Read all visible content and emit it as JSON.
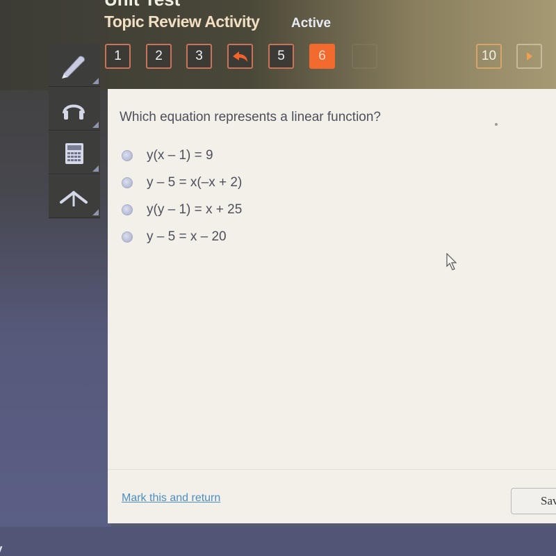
{
  "header": {
    "unit_title": "Unit Test",
    "activity_title": "Topic Review Activity",
    "status": "Active"
  },
  "question_nav": {
    "items": [
      {
        "label": "1",
        "state": "default"
      },
      {
        "label": "2",
        "state": "default"
      },
      {
        "label": "3",
        "state": "default"
      },
      {
        "label": "",
        "icon": "return-arrow-icon",
        "state": "marked"
      },
      {
        "label": "5",
        "state": "default"
      },
      {
        "label": "6",
        "state": "current"
      },
      {
        "label": "",
        "state": "hidden"
      },
      {
        "label": "10",
        "state": "default"
      },
      {
        "label": "",
        "icon": "next-arrow-icon",
        "state": "next"
      }
    ],
    "accent_color": "#f26a2e"
  },
  "tools": [
    {
      "name": "pencil",
      "icon": "pencil-icon"
    },
    {
      "name": "audio",
      "icon": "headphones-icon"
    },
    {
      "name": "calculator",
      "icon": "calculator-icon"
    },
    {
      "name": "reference",
      "icon": "compass-icon"
    }
  ],
  "question": {
    "prompt": "Which equation represents a linear function?",
    "options": [
      {
        "text": "y(x – 1) = 9",
        "selected": false
      },
      {
        "text": "y – 5 = x(–x + 2)",
        "selected": false
      },
      {
        "text": "y(y – 1) = x + 25",
        "selected": false
      },
      {
        "text": "y – 5 = x – 20",
        "selected": false
      }
    ]
  },
  "footer": {
    "mark_link": "Mark this and return",
    "save_button": "Save and Exit"
  },
  "bottom": {
    "text": "y"
  }
}
